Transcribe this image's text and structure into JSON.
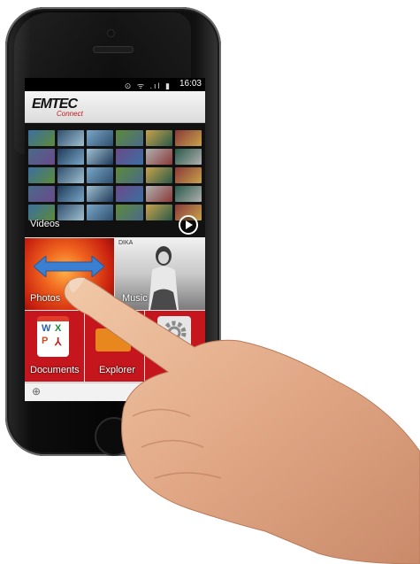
{
  "status_bar": {
    "time": "16:03",
    "icons": "⊙ ᯤ .ıl ▮"
  },
  "header": {
    "brand": "EMTEC",
    "brand_sub": "Connect"
  },
  "tiles": {
    "videos": "Videos",
    "photos": "Photos",
    "music": "Music",
    "documents": "Documents",
    "explorer": "Explorer"
  },
  "music_tile_caption": "DIKA",
  "doc_letters": [
    "W",
    "X",
    "P"
  ],
  "colors": {
    "accent_red": "#c4161c",
    "brand_red": "#c4161c",
    "status_bar": "#000000",
    "arrow_blue": "#3a7fd0"
  }
}
